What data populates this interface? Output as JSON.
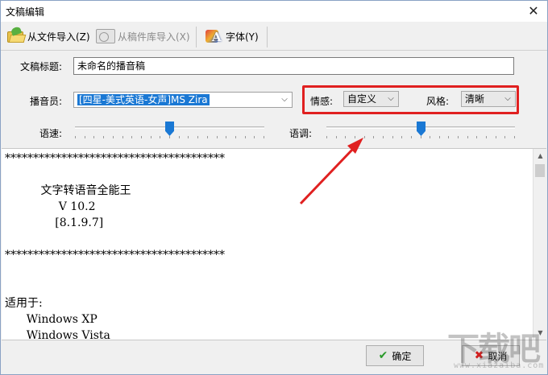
{
  "window": {
    "title": "文稿编辑",
    "close_glyph": "✕"
  },
  "toolbar": {
    "import_file": "从文件导入(Z)",
    "import_library": "从稿件库导入(X)",
    "font": "字体(Y)"
  },
  "form": {
    "title_label": "文稿标题:",
    "title_value": "未命名的播音稿",
    "speaker_label": "播音员:",
    "speaker_value": "[四星-美式英语-女声]MS Zira",
    "emotion_label": "情感:",
    "emotion_value": "自定义",
    "style_label": "风格:",
    "style_value": "清晰",
    "speed_label": "语速:",
    "speed_fraction": 0.5,
    "pitch_label": "语调:",
    "pitch_fraction": 0.5
  },
  "editor": {
    "lines": [
      "***************************************",
      "",
      "          文字转语音全能王",
      "               V 10.2",
      "              [8.1.9.7]",
      "",
      "***************************************",
      "",
      "",
      "适用于:",
      "      Windows XP",
      "      Windows Vista"
    ]
  },
  "buttons": {
    "ok": "确定",
    "cancel": "取消"
  },
  "watermark": {
    "big": "下载吧",
    "small": "www.xiazaiba.com"
  },
  "colors": {
    "accent": "#1a78d4",
    "highlight": "#e02020"
  }
}
